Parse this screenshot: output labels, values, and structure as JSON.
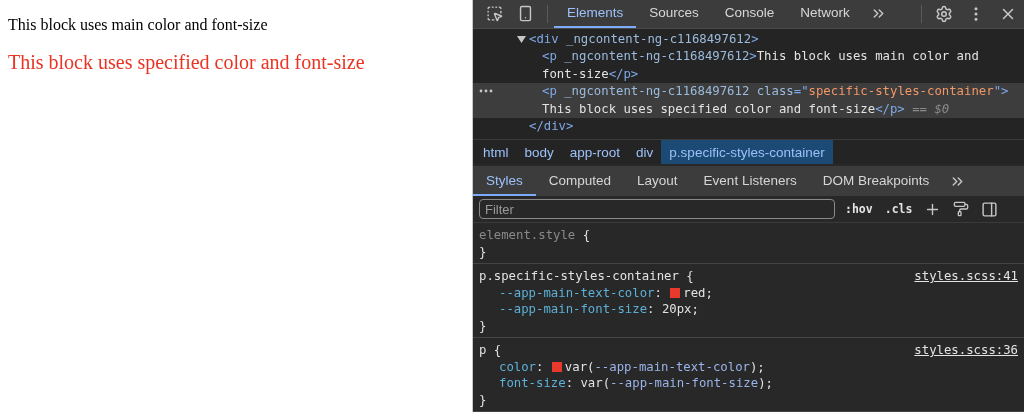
{
  "page": {
    "paragraphs": [
      {
        "kind": "main",
        "text": "This block uses main color and font-size"
      },
      {
        "kind": "specified",
        "text": "This block uses specified color and font-size"
      }
    ]
  },
  "devtools": {
    "tabs": [
      {
        "label": "Elements",
        "selected": true
      },
      {
        "label": "Sources",
        "selected": false
      },
      {
        "label": "Console",
        "selected": false
      },
      {
        "label": "Network",
        "selected": false
      }
    ],
    "dom_tree": [
      {
        "expanded": true,
        "selected": false,
        "lines": [
          [
            {
              "kind": "tag",
              "text": "<div"
            },
            {
              "kind": "attr",
              "text": " _ngcontent-ng-c1168497612"
            },
            {
              "kind": "tag",
              "text": ">"
            }
          ]
        ],
        "children": [
          {
            "selected": false,
            "lines": [
              [
                {
                  "kind": "tag",
                  "text": "<p"
                },
                {
                  "kind": "attr",
                  "text": " _ngcontent-ng-c1168497612"
                },
                {
                  "kind": "tag",
                  "text": ">"
                },
                {
                  "kind": "text",
                  "text": "This block uses main color and"
                }
              ],
              [
                {
                  "kind": "text",
                  "text": "font-size"
                },
                {
                  "kind": "tag",
                  "text": "</p>"
                }
              ]
            ]
          },
          {
            "selected": true,
            "lines": [
              [
                {
                  "kind": "tag",
                  "text": "<p"
                },
                {
                  "kind": "attr",
                  "text": " _ngcontent-ng-c1168497612 class"
                },
                {
                  "kind": "tag",
                  "text": "=\""
                },
                {
                  "kind": "value",
                  "text": "specific-styles-container"
                },
                {
                  "kind": "tag",
                  "text": "\">"
                }
              ],
              [
                {
                  "kind": "text",
                  "text": "This block uses specified color and font-size"
                },
                {
                  "kind": "tag",
                  "text": "</p>"
                },
                {
                  "kind": "dim",
                  "text": " == "
                },
                {
                  "kind": "dimitalic",
                  "text": "$0"
                }
              ]
            ]
          }
        ],
        "closing": [
          {
            "kind": "tag",
            "text": "</div>"
          }
        ]
      }
    ],
    "breadcrumbs": [
      {
        "label": "html",
        "selected": false
      },
      {
        "label": "body",
        "selected": false
      },
      {
        "label": "app-root",
        "selected": false
      },
      {
        "label": "div",
        "selected": false
      },
      {
        "label": "p.specific-styles-container",
        "selected": true
      }
    ],
    "subtabs": [
      {
        "label": "Styles",
        "selected": true
      },
      {
        "label": "Computed",
        "selected": false
      },
      {
        "label": "Layout",
        "selected": false
      },
      {
        "label": "Event Listeners",
        "selected": false
      },
      {
        "label": "DOM Breakpoints",
        "selected": false
      }
    ],
    "filter": {
      "placeholder": "Filter"
    },
    "filter_buttons": [
      ":hov",
      ".cls"
    ],
    "rules": [
      {
        "kind": "inline",
        "selector": "element.style",
        "open": "{",
        "close": "}"
      },
      {
        "kind": "rule",
        "selector": "p.specific-styles-container",
        "open": "{",
        "close": "}",
        "source": "styles.scss:41",
        "declarations": [
          [
            {
              "kind": "prop",
              "text": "--app-main-text-color"
            },
            {
              "kind": "plain",
              "text": ": "
            },
            {
              "kind": "swatch",
              "color": "#e8392c"
            },
            {
              "kind": "plain",
              "text": "red;"
            }
          ],
          [
            {
              "kind": "prop",
              "text": "--app-main-font-size"
            },
            {
              "kind": "plain",
              "text": ": 20px;"
            }
          ]
        ]
      },
      {
        "kind": "rule",
        "selector": "p",
        "open": "{",
        "close": "}",
        "source": "styles.scss:36",
        "declarations": [
          [
            {
              "kind": "prop",
              "text": "color"
            },
            {
              "kind": "plain",
              "text": ": "
            },
            {
              "kind": "swatch",
              "color": "#e8392c"
            },
            {
              "kind": "plain",
              "text": "var("
            },
            {
              "kind": "varname",
              "text": "--app-main-text-color"
            },
            {
              "kind": "plain",
              "text": ");"
            }
          ],
          [
            {
              "kind": "prop",
              "text": "font-size"
            },
            {
              "kind": "plain",
              "text": ": var("
            },
            {
              "kind": "varname",
              "text": "--app-main-font-size"
            },
            {
              "kind": "plain",
              "text": ");"
            }
          ]
        ]
      }
    ]
  }
}
